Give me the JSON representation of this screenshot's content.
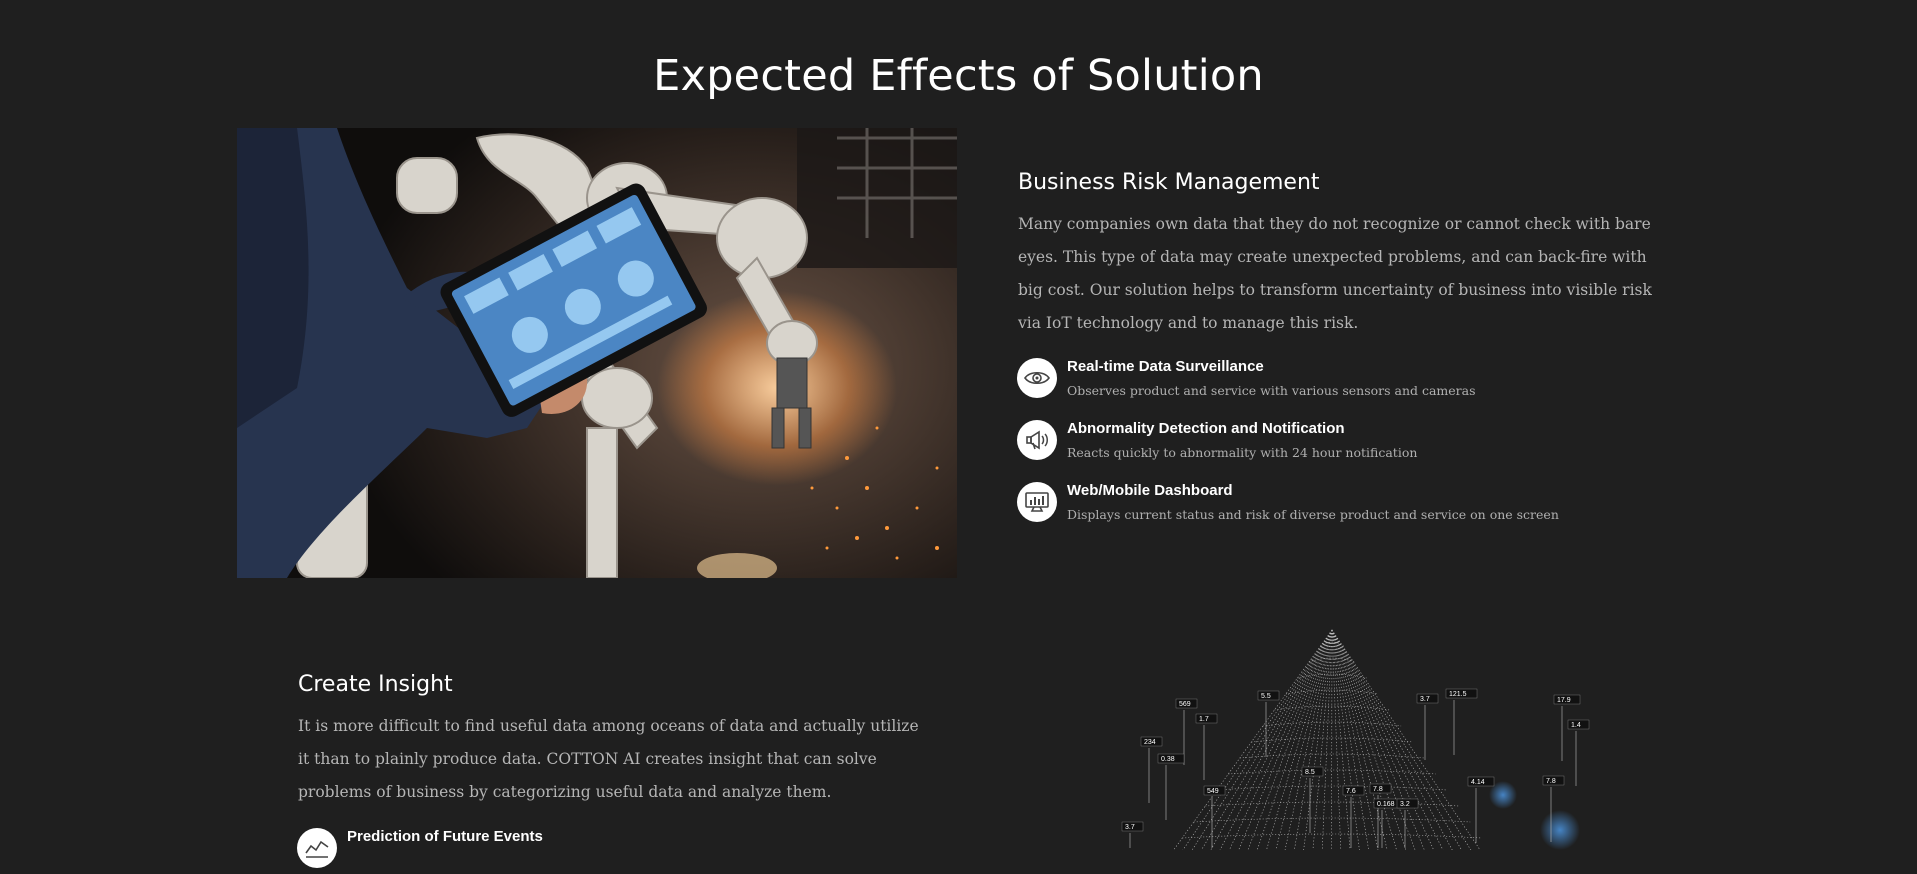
{
  "page": {
    "title": "Expected Effects of Solution"
  },
  "risk": {
    "heading": "Business Risk Management",
    "lines": [
      "Many companies own data that they do not recognize or cannot check with bare",
      "eyes. This type of data may create unexpected problems, and can back-fire with",
      "big cost. Our solution helps to transform uncertainty of business into visible risk",
      "via IoT technology and to manage this risk."
    ],
    "features": [
      {
        "icon": "eye-icon",
        "title": "Real-time Data Surveillance",
        "desc": "Observes product and service with various sensors and cameras"
      },
      {
        "icon": "megaphone-icon",
        "title": "Abnormality Detection and Notification",
        "desc": "Reacts quickly to abnormality with 24 hour notification"
      },
      {
        "icon": "dashboard-monitor-icon",
        "title": "Web/Mobile Dashboard",
        "desc": "Displays current status and risk of diverse product and service on one screen"
      }
    ]
  },
  "insight": {
    "heading": "Create Insight",
    "lines": [
      "It is more difficult to find useful data among oceans of data and actually utilize",
      "it than to plainly produce data. COTTON AI creates insight that can solve",
      "problems of business by categorizing useful data and analyze them."
    ],
    "features": [
      {
        "icon": "line-graph-icon",
        "title": "Prediction of Future Events"
      }
    ]
  },
  "viz_labels": [
    "569",
    "1.7",
    "5.5",
    "234",
    "0.38",
    "549",
    "3.7",
    "7.6",
    "3.7",
    "121.5",
    "17.9",
    "1.4",
    "8.5",
    "7.8",
    "4.14",
    "0.168",
    "3.2",
    "7.8"
  ]
}
